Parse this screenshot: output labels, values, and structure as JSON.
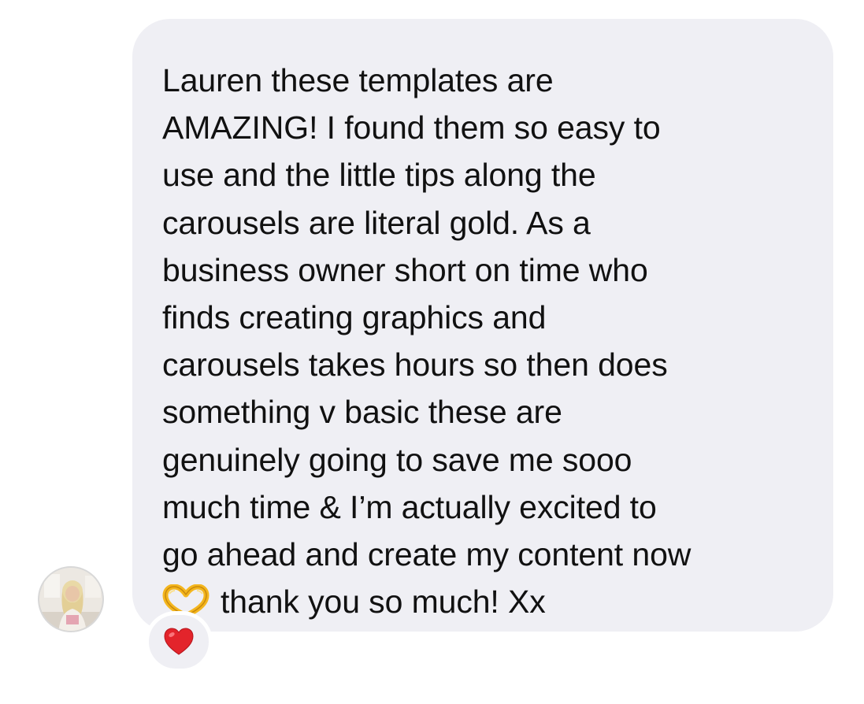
{
  "message": {
    "lines": [
      "Lauren these templates are",
      "AMAZING! I found them so easy to",
      "use and the little tips along the",
      "carousels are literal gold. As a",
      "business owner short on time who",
      "finds creating graphics and",
      "carousels takes hours so then does",
      "something v basic these are",
      "genuinely going to save me sooo",
      "much time & I’m actually excited to",
      "go ahead and create my content now",
      "thank you so much! Xx"
    ],
    "inline_emoji": "heart-hands-icon"
  },
  "reaction": {
    "emoji": "red-heart-icon"
  },
  "avatar": {
    "icon": "avatar"
  },
  "colors": {
    "bubble": "#efeff4",
    "text": "#111111",
    "heart": "#e3242b"
  }
}
